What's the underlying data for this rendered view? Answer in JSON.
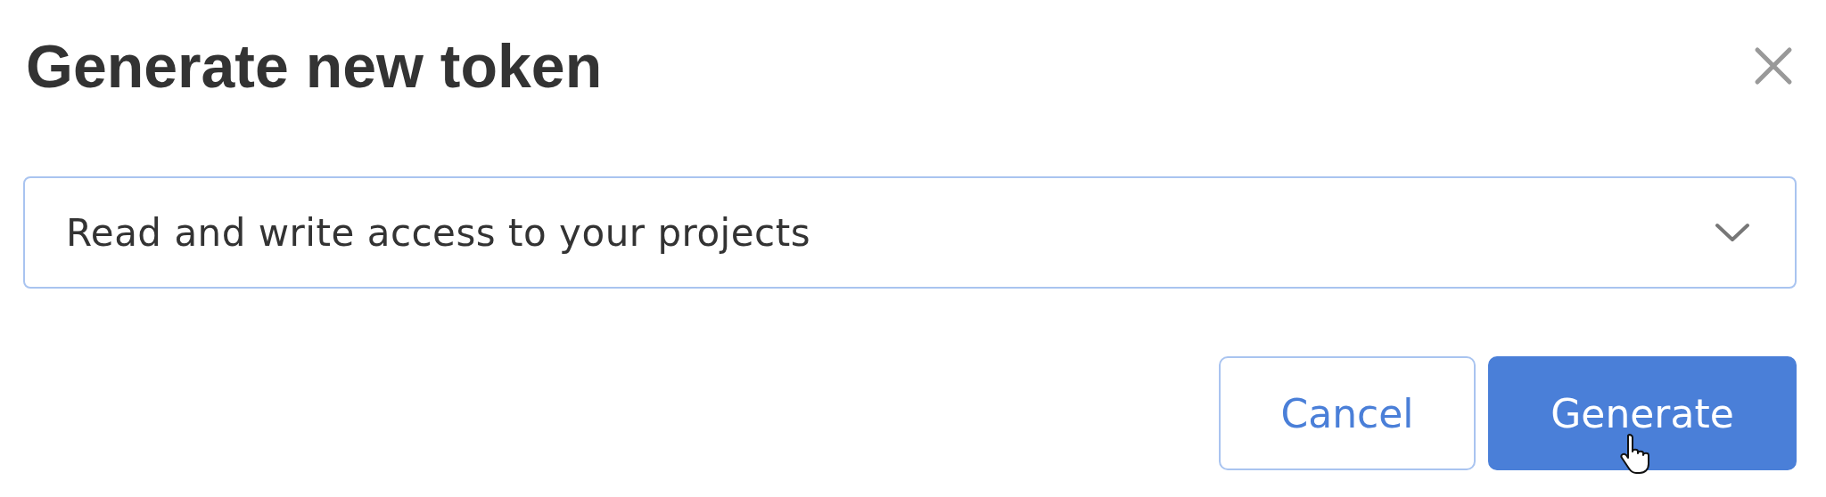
{
  "dialog": {
    "title": "Generate new token",
    "scope_select": {
      "value": "Read and write access to your projects"
    },
    "buttons": [
      {
        "label": "Cancel",
        "kind": "secondary"
      },
      {
        "label": "Generate",
        "kind": "primary"
      }
    ]
  }
}
